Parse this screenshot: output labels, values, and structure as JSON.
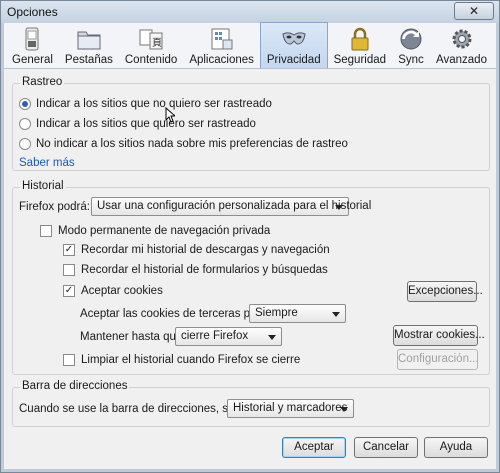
{
  "window": {
    "title": "Opciones",
    "close_label": "✕"
  },
  "toolbar": {
    "items": [
      {
        "label": "General",
        "icon": "switch-icon"
      },
      {
        "label": "Pestañas",
        "icon": "folder-tabs-icon"
      },
      {
        "label": "Contenido",
        "icon": "content-icon"
      },
      {
        "label": "Aplicaciones",
        "icon": "applications-icon"
      },
      {
        "label": "Privacidad",
        "icon": "mask-icon",
        "selected": true
      },
      {
        "label": "Seguridad",
        "icon": "padlock-icon"
      },
      {
        "label": "Sync",
        "icon": "sync-icon"
      },
      {
        "label": "Avanzado",
        "icon": "gear-icon"
      }
    ]
  },
  "rastreo": {
    "title": "Rastreo",
    "options": [
      {
        "label": "Indicar a los sitios que no quiero ser rastreado",
        "selected": true
      },
      {
        "label": "Indicar a los sitios que quiero ser rastreado",
        "selected": false
      },
      {
        "label": "No indicar a los sitios nada sobre mis preferencias de rastreo",
        "selected": false
      }
    ],
    "learn_more": "Saber más"
  },
  "historial": {
    "title": "Historial",
    "firefox_label": "Firefox podrá:",
    "firefox_value": "Usar una configuración personalizada para el historial",
    "private_mode": {
      "label": "Modo permanente de navegación privada",
      "checked": false
    },
    "remember_downloads": {
      "label": "Recordar mi historial de descargas y navegación",
      "checked": true
    },
    "remember_forms": {
      "label": "Recordar el historial de formularios y búsquedas",
      "checked": false
    },
    "accept_cookies": {
      "label": "Aceptar cookies",
      "checked": true
    },
    "exceptions_button": "Excepciones...",
    "third_party_label": "Aceptar las cookies de terceras partes:",
    "third_party_value": "Siempre",
    "keep_until_label": "Mantener hasta que:",
    "keep_until_value": "cierre Firefox",
    "show_cookies_button": "Mostrar cookies...",
    "clear_on_close": {
      "label": "Limpiar el historial cuando Firefox se cierre",
      "checked": false
    },
    "settings_button": "Configuración..."
  },
  "address_bar": {
    "title": "Barra de direcciones",
    "suggest_label": "Cuando se use la barra de direcciones, sugerir:",
    "suggest_value": "Historial y marcadores"
  },
  "footer": {
    "accept": "Aceptar",
    "cancel": "Cancelar",
    "help": "Ayuda"
  }
}
